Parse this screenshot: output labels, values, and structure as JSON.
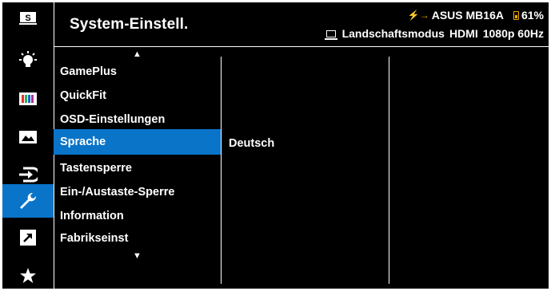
{
  "header": {
    "title": "System-Einstell.",
    "brand_prefix": "⚡",
    "model": "ASUS MB16A",
    "battery_percent": "61%",
    "mode": "Landschaftsmodus",
    "input": "HDMI",
    "resolution": "1080p 60Hz"
  },
  "sidebar": {
    "items": [
      {
        "name": "splendid",
        "icon": "s-box-icon"
      },
      {
        "name": "blue-light",
        "icon": "lightbulb-icon"
      },
      {
        "name": "color",
        "icon": "color-bars-icon"
      },
      {
        "name": "image",
        "icon": "image-icon"
      },
      {
        "name": "input",
        "icon": "input-icon"
      },
      {
        "name": "system",
        "icon": "wrench-icon",
        "active": true
      },
      {
        "name": "shortcut",
        "icon": "shortcut-arrow-icon"
      },
      {
        "name": "favorite",
        "icon": "star-icon"
      }
    ]
  },
  "menu": {
    "items": [
      {
        "label": "GamePlus"
      },
      {
        "label": "QuickFit"
      },
      {
        "label": "OSD-Einstellungen"
      },
      {
        "label": "Sprache",
        "active": true
      },
      {
        "label": "Tastensperre"
      },
      {
        "label": "Ein-/Austaste-Sperre"
      },
      {
        "label": "Information"
      },
      {
        "label": "Fabrikseinst"
      }
    ],
    "up_arrow": "▲",
    "down_arrow": "▼"
  },
  "submenu": {
    "value": "Deutsch"
  },
  "colors": {
    "accent": "#0a74c9",
    "battery": "#f5a800",
    "background": "#000000",
    "text": "#ffffff"
  }
}
